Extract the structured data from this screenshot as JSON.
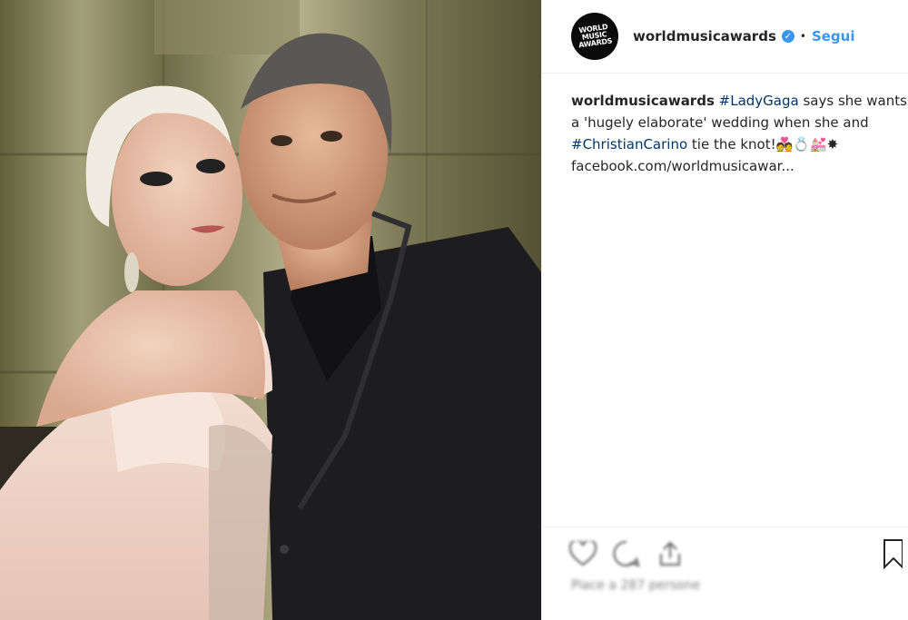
{
  "post": {
    "photo_icon": "photo-of-couple-at-event",
    "header": {
      "avatar_text": [
        "WORLD",
        "MUSIC",
        "AWARDS"
      ],
      "username": "worldmusicawards",
      "verified_icon": "verified-badge-icon",
      "separator": "•",
      "follow_label": "Segui"
    },
    "caption": {
      "username": "worldmusicawards",
      "tag1": "#LadyGaga",
      "text1": " says she wants",
      "line2": "a 'hugely elaborate' wedding when she and",
      "tag2": "#ChristianCarino",
      "text2": " tie the knot!💑💍💒✸",
      "link": "facebook.com/worldmusicawar..."
    },
    "actions": {
      "icons": [
        "heart-icon",
        "comment-icon",
        "share-icon",
        "bookmark-icon"
      ],
      "likes_text": "Piace a 287 persone"
    },
    "colors": {
      "link_blue": "#3897f0",
      "hashtag": "#003569",
      "text": "#262626",
      "border": "#efefef"
    }
  }
}
